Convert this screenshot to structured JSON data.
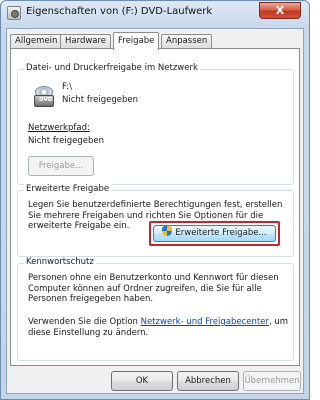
{
  "window": {
    "title": "Eigenschaften von (F:) DVD-Laufwerk",
    "close_label": "X"
  },
  "tabs": [
    {
      "label": "Allgemein"
    },
    {
      "label": "Hardware"
    },
    {
      "label": "Freigabe"
    },
    {
      "label": "Anpassen"
    }
  ],
  "network_sharing": {
    "group_title": "Datei- und Druckerfreigabe im Netzwerk",
    "drive_path": "F:\\",
    "drive_status": "Nicht freigegeben",
    "drive_icon_label": "DVD",
    "network_path_label": "Netzwerkpfad:",
    "network_path_value": "Nicht freigegeben",
    "share_button": "Freigabe..."
  },
  "advanced_sharing": {
    "group_title": "Erweiterte Freigabe",
    "description": "Legen Sie benutzerdefinierte Berechtigungen fest, erstellen Sie mehrere Freigaben und richten Sie Optionen für die erweiterte Freigabe ein.",
    "button": "Erweiterte Freigabe..."
  },
  "password_protection": {
    "group_title": "Kennwortschutz",
    "description": "Personen ohne ein Benutzerkonto und Kennwort für diesen Computer können auf Ordner zugreifen, die Sie für alle Personen freigegeben haben.",
    "hint_prefix": "Verwenden Sie die Option ",
    "hint_link": "Netzwerk- und Freigabecenter",
    "hint_suffix": ", um diese Einstellung zu ändern."
  },
  "footer": {
    "ok": "OK",
    "cancel": "Abbrechen",
    "apply": "Übernehmen"
  },
  "colors": {
    "highlight_border": "#c0262d",
    "link": "#0645c8"
  }
}
